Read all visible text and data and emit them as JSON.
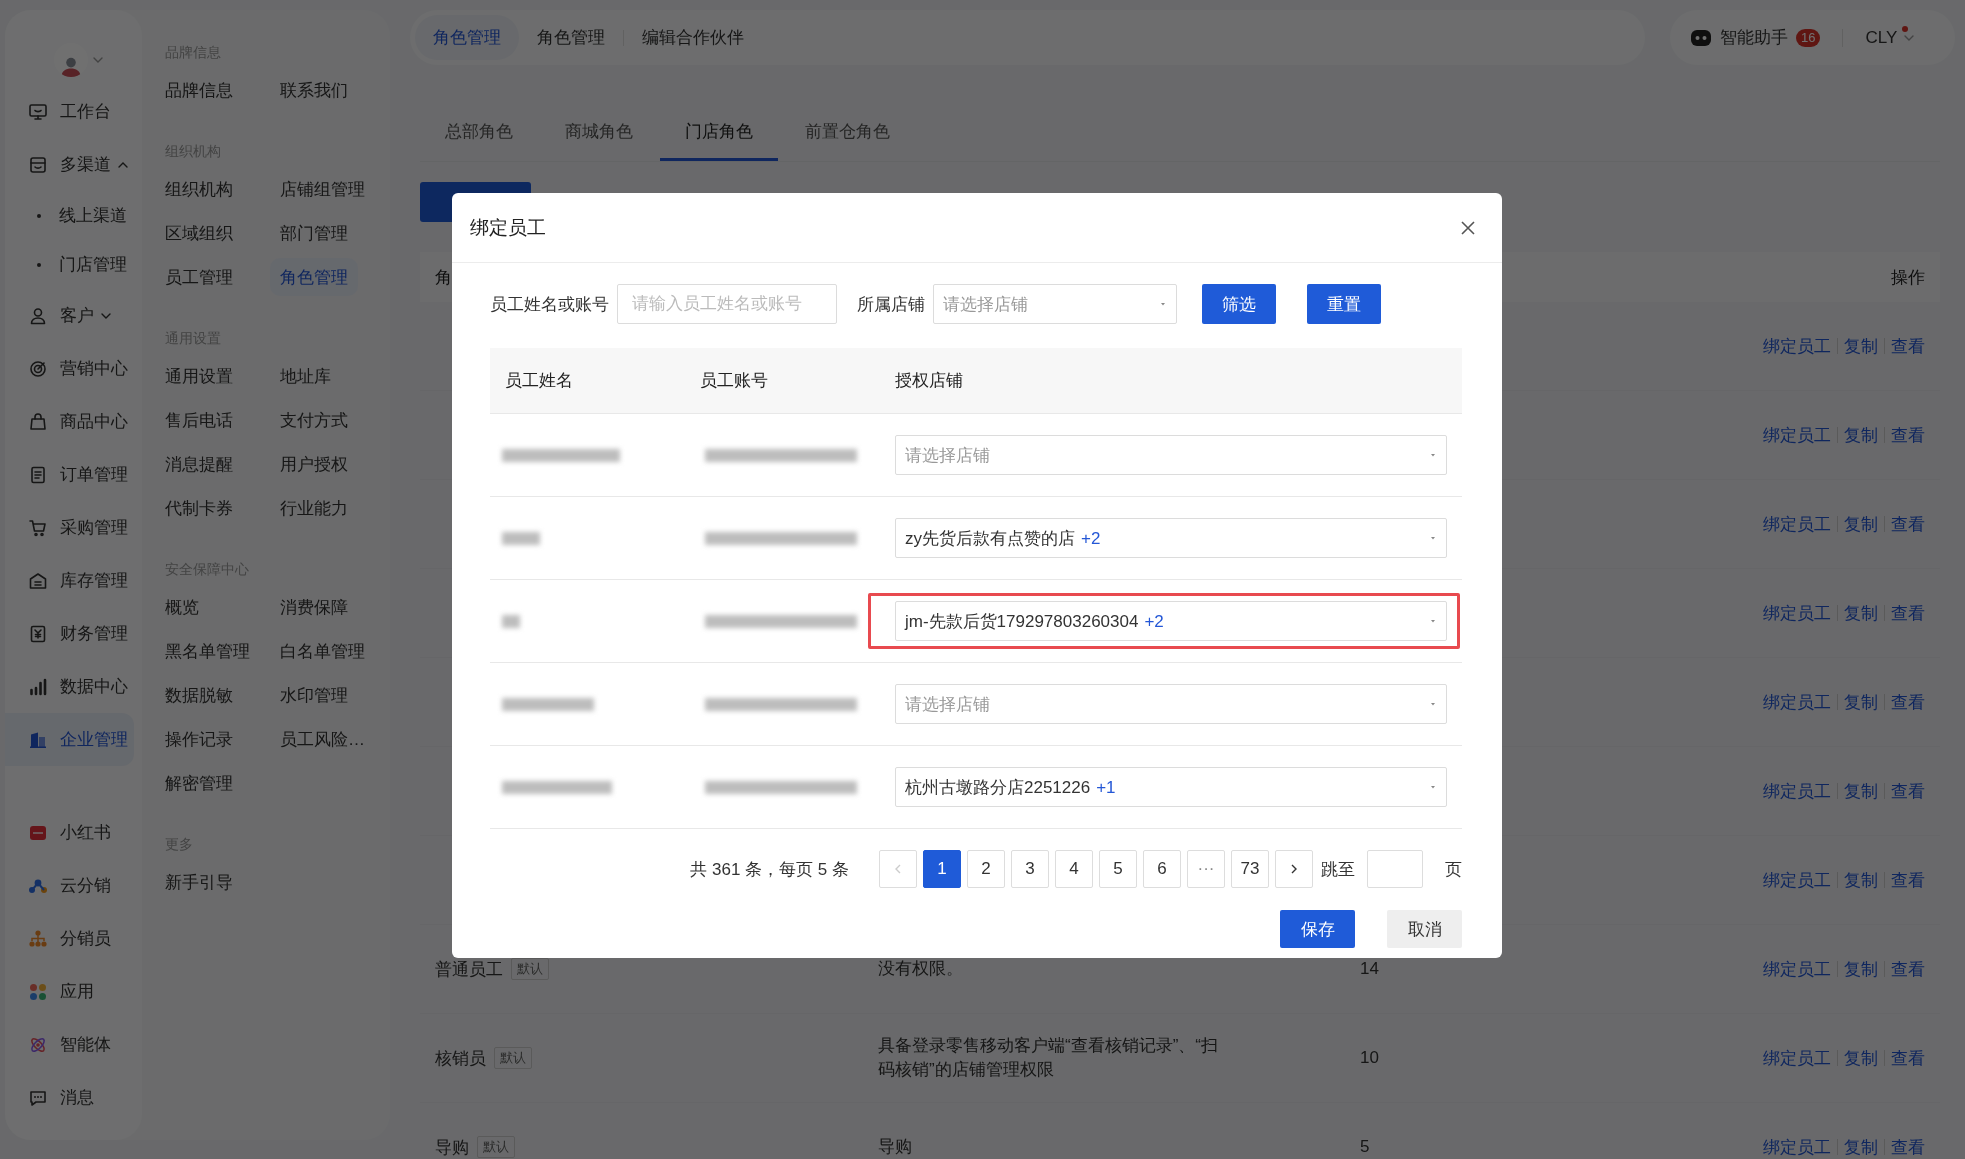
{
  "nav": {
    "items": [
      {
        "label": "工作台",
        "selected": false
      },
      {
        "label": "多渠道",
        "selected": false,
        "expanded": true,
        "children": [
          {
            "label": "线上渠道",
            "selected": false
          },
          {
            "label": "门店管理",
            "selected": false
          }
        ]
      },
      {
        "label": "客户",
        "selected": false,
        "expanded": false
      },
      {
        "label": "营销中心",
        "selected": false
      },
      {
        "label": "商品中心",
        "selected": false
      },
      {
        "label": "订单管理",
        "selected": false
      },
      {
        "label": "采购管理",
        "selected": false
      },
      {
        "label": "库存管理",
        "selected": false
      },
      {
        "label": "财务管理",
        "selected": false
      },
      {
        "label": "数据中心",
        "selected": false
      },
      {
        "label": "企业管理",
        "selected": true
      }
    ],
    "apps": [
      {
        "label": "小红书"
      },
      {
        "label": "云分销"
      },
      {
        "label": "分销员"
      },
      {
        "label": "应用"
      },
      {
        "label": "智能体"
      },
      {
        "label": "消息"
      }
    ]
  },
  "submenu": {
    "groups": [
      {
        "title": "品牌信息",
        "items": [
          {
            "label": "品牌信息",
            "selected": false
          },
          {
            "label": "联系我们",
            "selected": false
          }
        ]
      },
      {
        "title": "组织机构",
        "items": [
          {
            "label": "组织机构",
            "selected": false
          },
          {
            "label": "店铺组管理",
            "selected": false
          },
          {
            "label": "区域组织",
            "selected": false
          },
          {
            "label": "部门管理",
            "selected": false
          },
          {
            "label": "员工管理",
            "selected": false
          },
          {
            "label": "角色管理",
            "selected": true
          }
        ]
      },
      {
        "title": "通用设置",
        "items": [
          {
            "label": "通用设置",
            "selected": false
          },
          {
            "label": "地址库",
            "selected": false
          },
          {
            "label": "售后电话",
            "selected": false
          },
          {
            "label": "支付方式",
            "selected": false
          },
          {
            "label": "消息提醒",
            "selected": false
          },
          {
            "label": "用户授权",
            "selected": false
          },
          {
            "label": "代制卡券",
            "selected": false
          },
          {
            "label": "行业能力",
            "selected": false
          }
        ]
      },
      {
        "title": "安全保障中心",
        "items": [
          {
            "label": "概览",
            "selected": false
          },
          {
            "label": "消费保障",
            "selected": false
          },
          {
            "label": "黑名单管理",
            "selected": false
          },
          {
            "label": "白名单管理",
            "selected": false
          },
          {
            "label": "数据脱敏",
            "selected": false
          },
          {
            "label": "水印管理",
            "selected": false
          },
          {
            "label": "操作记录",
            "selected": false
          },
          {
            "label": "员工风险…",
            "selected": false
          },
          {
            "label": "解密管理",
            "selected": false
          }
        ]
      },
      {
        "title": "更多",
        "items": [
          {
            "label": "新手引导",
            "selected": false
          }
        ]
      }
    ]
  },
  "top_tabs": [
    {
      "label": "角色管理",
      "selected": true
    },
    {
      "label": "角色管理",
      "selected": false
    },
    {
      "label": "编辑合作伙伴",
      "selected": false
    }
  ],
  "assistant": {
    "label": "智能助手",
    "badge": "16"
  },
  "user": {
    "name": "CLY",
    "unread": true
  },
  "role_tabs": [
    {
      "label": "总部角色",
      "selected": false
    },
    {
      "label": "商城角色",
      "selected": false
    },
    {
      "label": "门店角色",
      "selected": true
    },
    {
      "label": "前置仓角色",
      "selected": false
    }
  ],
  "role_table": {
    "column_1": "角",
    "actions_header": "操作",
    "rows": [
      {
        "actions": [
          "绑定员工",
          "复制",
          "查看"
        ]
      },
      {
        "actions": [
          "绑定员工",
          "复制",
          "查看"
        ]
      },
      {
        "actions": [
          "绑定员工",
          "复制",
          "查看"
        ]
      },
      {
        "actions": [
          "绑定员工",
          "复制",
          "查看"
        ]
      },
      {
        "actions": [
          "绑定员工",
          "复制",
          "查看"
        ]
      },
      {
        "actions": [
          "绑定员工",
          "复制",
          "查看"
        ]
      },
      {
        "actions": [
          "绑定员工",
          "复制",
          "查看"
        ]
      },
      {
        "name": "普通员工",
        "tag": "默认",
        "description": "没有权限。",
        "count": "14",
        "actions": [
          "绑定员工",
          "复制",
          "查看"
        ]
      },
      {
        "name": "核销员",
        "tag": "默认",
        "description": "具备登录零售移动客户端“查看核销记录”、“扫码核销”的店铺管理权限",
        "count": "10",
        "actions": [
          "绑定员工",
          "复制",
          "查看"
        ]
      },
      {
        "name": "导购",
        "tag": "默认",
        "description": "导购",
        "count": "5",
        "actions": [
          "绑定员工",
          "复制",
          "查看"
        ]
      }
    ]
  },
  "dialog": {
    "title": "绑定员工",
    "filters": {
      "name_label": "员工姓名或账号",
      "name_placeholder": "请输入员工姓名或账号",
      "store_label": "所属店铺",
      "store_placeholder": "请选择店铺",
      "filter_button": "筛选",
      "reset_button": "重置"
    },
    "columns": [
      "员工姓名",
      "员工账号",
      "授权店铺"
    ],
    "rows": [
      {
        "highlighted": false,
        "store": {
          "placeholder": "请选择店铺"
        }
      },
      {
        "highlighted": false,
        "store": {
          "value": "zy先货后款有点赞的店",
          "extra": "+2"
        }
      },
      {
        "highlighted": true,
        "store": {
          "value": "jm-先款后货179297803260304",
          "extra": "+2"
        }
      },
      {
        "highlighted": false,
        "store": {
          "placeholder": "请选择店铺"
        }
      },
      {
        "highlighted": false,
        "store": {
          "value": "杭州古墩路分店2251226",
          "extra": "+1"
        }
      }
    ],
    "pagination": {
      "summary": "共 361 条，每页 5 条",
      "prev": {
        "disabled": true
      },
      "next": {
        "disabled": false
      },
      "pages": [
        {
          "label": "1",
          "kind": "page",
          "selected": true
        },
        {
          "label": "2",
          "kind": "page",
          "selected": false
        },
        {
          "label": "3",
          "kind": "page",
          "selected": false
        },
        {
          "label": "4",
          "kind": "page",
          "selected": false
        },
        {
          "label": "5",
          "kind": "page",
          "selected": false
        },
        {
          "label": "6",
          "kind": "page",
          "selected": false
        },
        {
          "label": "···",
          "kind": "more",
          "selected": false
        },
        {
          "label": "73",
          "kind": "page",
          "selected": false
        }
      ],
      "jump_label": "跳至",
      "page_unit": "页"
    },
    "actions": [
      {
        "label": "保存",
        "kind": "primary"
      },
      {
        "label": "取消",
        "kind": "default"
      }
    ]
  }
}
